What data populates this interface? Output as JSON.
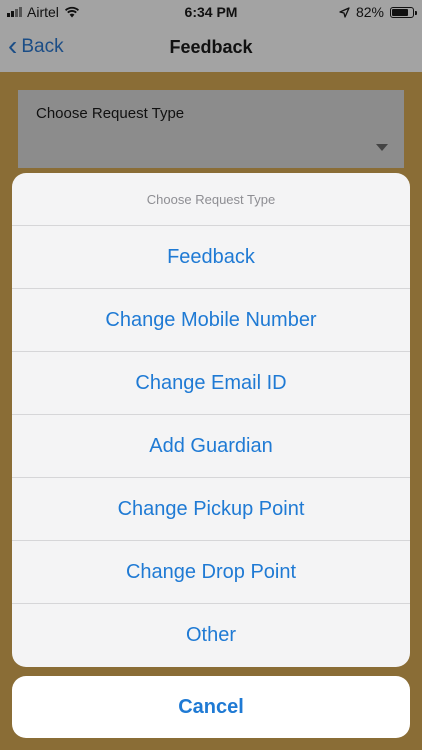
{
  "status": {
    "carrier": "Airtel",
    "time": "6:34 PM",
    "battery": "82%",
    "battery_level": 0.82
  },
  "nav": {
    "back_label": "Back",
    "title": "Feedback"
  },
  "form": {
    "request_type_label": "Choose Request Type"
  },
  "sheet": {
    "title": "Choose Request Type",
    "options": [
      "Feedback",
      "Change Mobile Number",
      "Change Email ID",
      "Add Guardian",
      "Change Pickup Point",
      "Change Drop Point",
      "Other"
    ],
    "cancel_label": "Cancel"
  },
  "colors": {
    "accent": "#1f7ad4",
    "backdrop": "#8a6d36"
  }
}
